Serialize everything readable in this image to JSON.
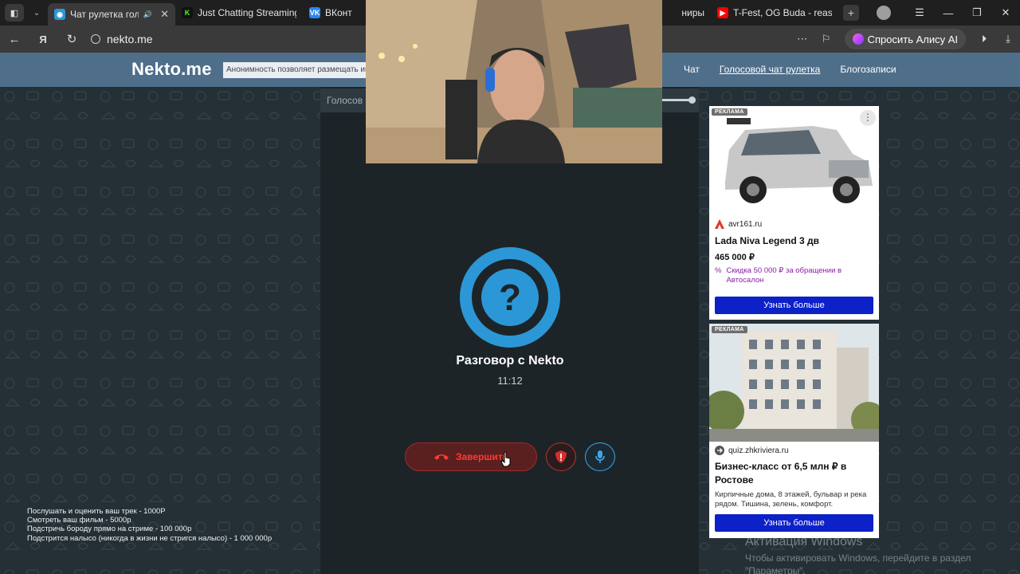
{
  "browser": {
    "tabs": [
      {
        "title": "Чат рулетка голосо",
        "favicon": "nekto-favicon",
        "color": "#2c97d6",
        "active": true
      },
      {
        "title": "Just Chatting Streaming",
        "favicon": "kick-favicon",
        "color": "#53fc18",
        "active": false
      },
      {
        "title": "ВКонтакт",
        "favicon": "vk-favicon",
        "color": "#2787f5",
        "active": false
      },
      {
        "title": "ниры",
        "favicon": "",
        "color": "",
        "active": false
      },
      {
        "title": "T-Fest, OG Buda - reason",
        "favicon": "youtube-favicon",
        "color": "#ff0000",
        "active": false
      }
    ],
    "url": "nekto.me",
    "alice_button": "Спросить Алису AI"
  },
  "site": {
    "logo": "Nekto.me",
    "notice": "Анонимность позволяет размещать инф",
    "nav": [
      "Чат",
      "Голосовой чат рулетка",
      "Блогозаписи"
    ]
  },
  "chat": {
    "bar_label": "Голосов",
    "avatar_symbol": "?",
    "partner_name": "Разговор с Nekto",
    "timer": "11:12",
    "end_button": "Завершить",
    "accent": "#2c97d6",
    "end_color": "#ff3b30"
  },
  "stream_overlay": [
    "Послушать и оценить ваш трек - 1000Р",
    "Смотреть ваш фильм - 5000р",
    "Подстричь бороду прямо на стриме - 100 000р",
    "Подстрится налысо (никогда в жизни не стригся налысо) - 1 000 000р"
  ],
  "ads": [
    {
      "label": "РЕКЛАМА",
      "domain": "avr161.ru",
      "title": "Lada Niva Legend 3 дв",
      "price": "465 000 ₽",
      "promo": "Скидка 50 000 ₽ за обращении в Автосалон",
      "cta": "Узнать больше"
    },
    {
      "label": "РЕКЛАМА",
      "domain": "quiz.zhkriviera.ru",
      "title": "Бизнес-класс от 6,5 млн ₽ в Ростове",
      "description": "Кирпичные дома, 8 этажей, бульвар и река рядом. Тишина, зелень, комфорт.",
      "cta": "Узнать больше"
    }
  ],
  "windows_activation": {
    "title": "Активация Windows",
    "subtitle": "Чтобы активировать Windows, перейдите в раздел \"Параметры\"."
  }
}
